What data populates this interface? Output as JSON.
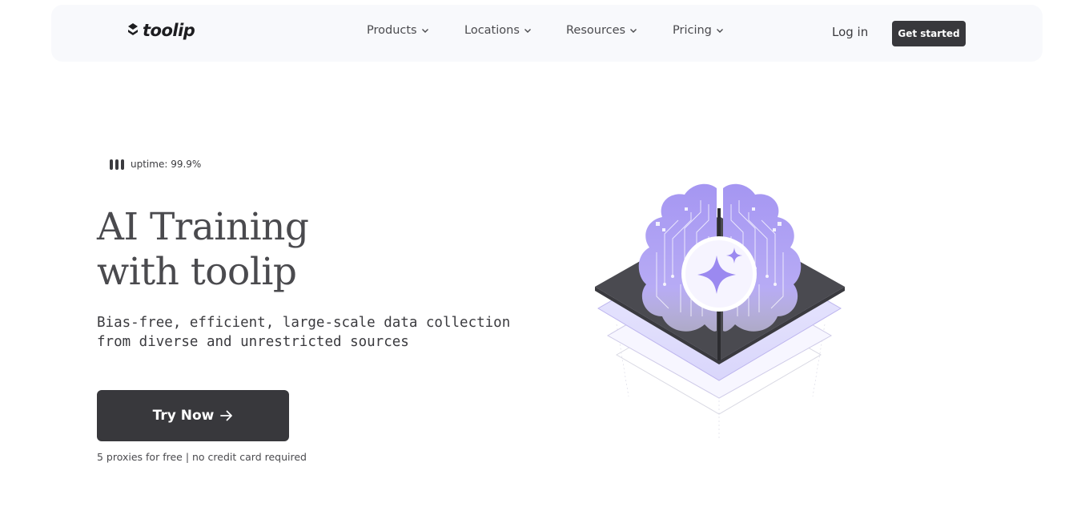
{
  "nav": {
    "logo_text": "toolip",
    "menu": [
      {
        "label": "Products"
      },
      {
        "label": "Locations"
      },
      {
        "label": "Resources"
      },
      {
        "label": "Pricing"
      }
    ],
    "login_label": "Log in",
    "cta_label": "Get started"
  },
  "hero": {
    "uptime": "uptime: 99.9%",
    "title_line1": "AI Training",
    "title_line2": "with toolip",
    "subtitle_line1": "Bias-free, efficient, large-scale data collection",
    "subtitle_line2": "from diverse and unrestricted sources",
    "button_label": "Try Now",
    "note": "5 proxies for free | no credit card required"
  },
  "icons": {
    "logo": "toolip-logo-mark",
    "chevron": "chevron-down-icon",
    "arrow": "arrow-right-icon",
    "uptime": "uptime-bars-icon",
    "illustration": "ai-brain-chip-illustration"
  },
  "colors": {
    "primary_dark": "#38383c",
    "nav_bg": "#f8f9fc",
    "brain_purple": "#a596f2",
    "text": "#3b3b3f"
  }
}
